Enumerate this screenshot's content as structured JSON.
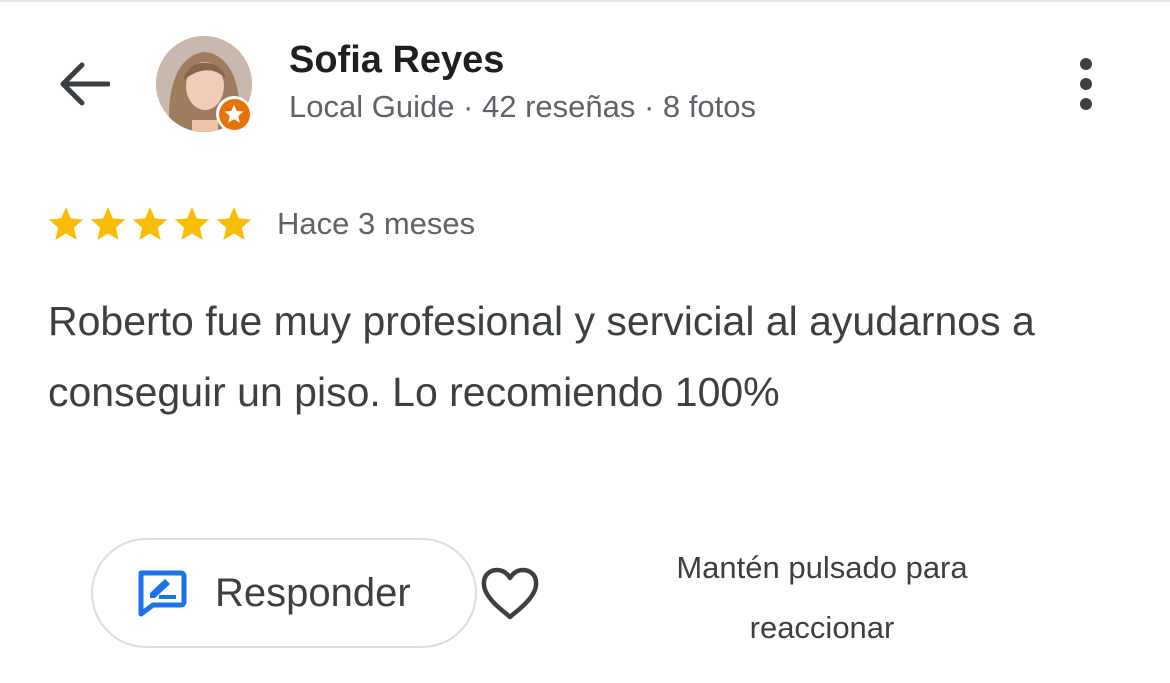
{
  "review": {
    "author": {
      "name": "Sofia Reyes",
      "meta": "Local Guide · 42 reseñas · 8 fotos",
      "badge": "local-guide-star-icon"
    },
    "rating": 5,
    "rating_max": 5,
    "date": "Hace 3 meses",
    "text": "Roberto fue muy profesional y servicial al ayudarnos a conseguir un piso. Lo recomiendo 100%"
  },
  "actions": {
    "reply_label": "Responder",
    "react_hint": "Mantén pulsado para reaccionar"
  },
  "icons": {
    "back": "arrow-back-icon",
    "more": "more-vert-icon",
    "reply": "reply-edit-icon",
    "like": "heart-icon",
    "star": "star-icon"
  },
  "colors": {
    "star": "#fbbc04",
    "accent_blue": "#1a73e8",
    "guide_badge": "#e8710a",
    "secondary_text": "#5f6368"
  }
}
